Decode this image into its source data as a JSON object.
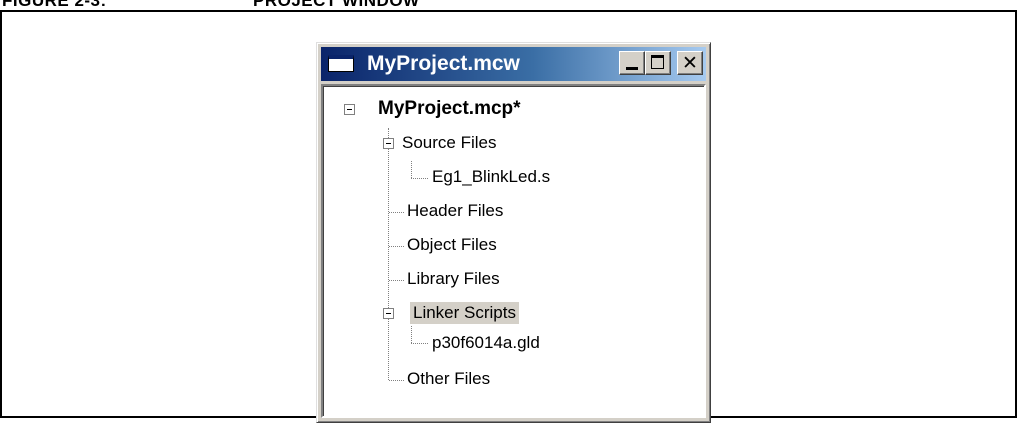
{
  "figure": {
    "number": "FIGURE 2-3:",
    "title": "PROJECT WINDOW"
  },
  "window": {
    "title": "MyProject.mcw",
    "buttons": {
      "minimize": "_",
      "maximize": "□",
      "close": "✕"
    }
  },
  "tree": {
    "root": {
      "label": "MyProject.mcp*",
      "expanded": true
    },
    "items": [
      {
        "label": "Source Files",
        "expanded": true,
        "children": [
          {
            "label": "Eg1_BlinkLed.s"
          }
        ]
      },
      {
        "label": "Header Files"
      },
      {
        "label": "Object Files"
      },
      {
        "label": "Library Files"
      },
      {
        "label": "Linker Scripts",
        "expanded": true,
        "selected": true,
        "children": [
          {
            "label": "p30f6014a.gld"
          }
        ]
      },
      {
        "label": "Other Files"
      }
    ]
  },
  "colors": {
    "titlebar_start": "#0a246a",
    "titlebar_end": "#a6caf0",
    "window_face": "#d4d0c8",
    "selection": "#d4d0c8"
  }
}
